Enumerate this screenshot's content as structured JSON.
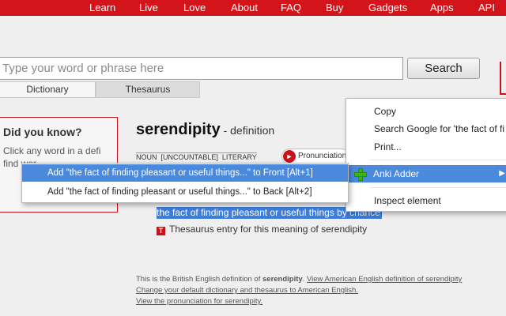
{
  "nav": {
    "items": [
      "Learn",
      "Live",
      "Love",
      "About",
      "FAQ",
      "Buy",
      "Gadgets",
      "Apps",
      "API"
    ],
    "bg_color": "#d3141b"
  },
  "search": {
    "placeholder": "Type your word or phrase here",
    "button_label": "Search"
  },
  "tabs": [
    "Dictionary",
    "Thesaurus"
  ],
  "did_you_know": {
    "title": "Did you know?",
    "text": "Click any word in a defi find wor"
  },
  "entry": {
    "headword": "serendipity",
    "suffix": " - definition",
    "grammar": "NOUN  [UNCOUNTABLE]  LITERARY",
    "pronunciation_label": "Pronunciation",
    "selected_definition": "the fact of finding pleasant or useful things by chance",
    "thesaurus_icon": "T",
    "thesaurus_link": "Thesaurus entry for this meaning of serendipity"
  },
  "footer": {
    "line1_prefix": "This is the British English definition of ",
    "line1_word": "serendipity",
    "line1_suffix": ". ",
    "line1_link": "View American English definition of serendipity",
    "line2_link": "Change your default dictionary and thesaurus to American English.",
    "line3_link": "View the pronunciation for serendipity."
  },
  "context_menu": {
    "items": [
      "Copy",
      "Search Google for 'the fact of fi",
      "Print...",
      "Anki Adder",
      "Inspect element"
    ],
    "highlight_color": "#4a89dc"
  },
  "submenu": {
    "items": [
      "Add \"the fact of finding pleasant or useful things...\" to Front [Alt+1]",
      "Add \"the fact of finding pleasant or useful things...\" to Back [Alt+2]"
    ]
  }
}
